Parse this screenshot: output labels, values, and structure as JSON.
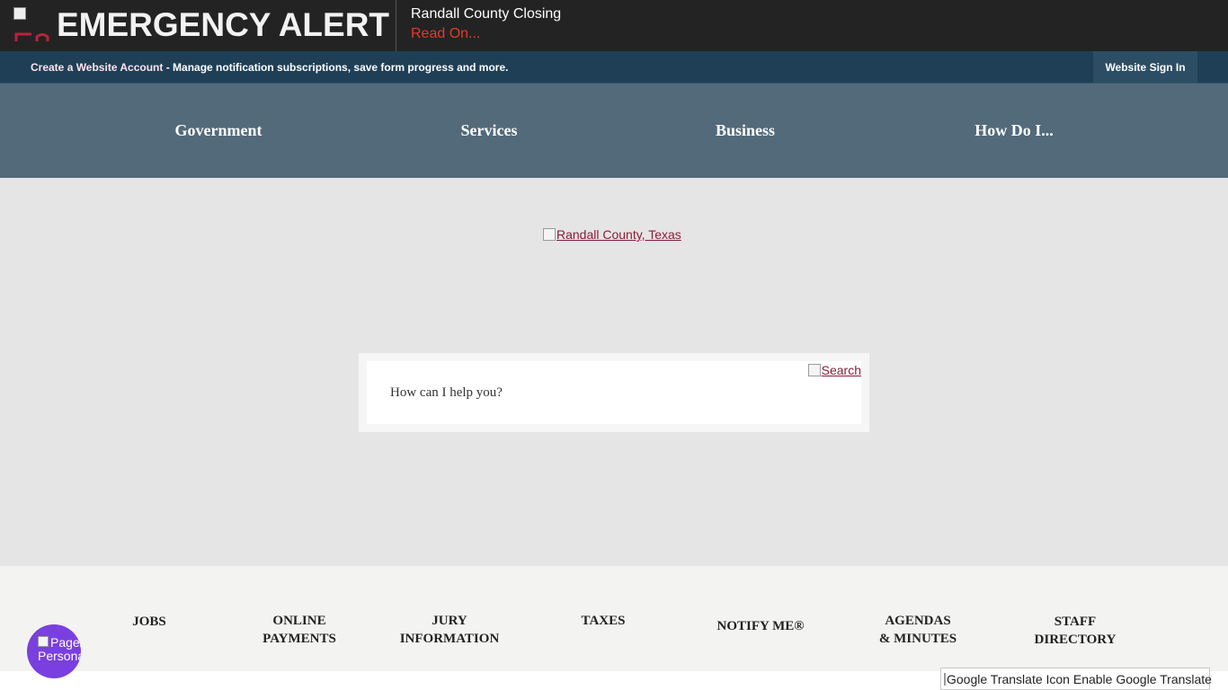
{
  "alert": {
    "title": "EMERGENCY ALERT",
    "message": "Randall County Closing",
    "read_on": "Read On..."
  },
  "account": {
    "create_link": "Create a Website Account",
    "description": " - Manage notification subscriptions, save form progress and more.",
    "sign_in": "Website Sign In"
  },
  "nav": {
    "items": [
      "Government",
      "Services",
      "Business",
      "How Do I..."
    ]
  },
  "hero": {
    "logo_alt": "Randall County, Texas",
    "search_placeholder": "How can I help you?",
    "search_alt": "Search"
  },
  "quick_links": [
    "JOBS",
    "ONLINE\nPAYMENTS",
    "JURY\nINFORMATION",
    "TAXES",
    "NOTIFY ME®",
    "AGENDAS\n& MINUTES",
    "STAFF\nDIRECTORY"
  ],
  "widgets": {
    "page_assist": "PageAssist Personalize",
    "translate": "Google Translate Icon Enable Google Translate"
  },
  "colors": {
    "alert_bg": "#232323",
    "alert_accent": "#e23a2b",
    "account_bg": "#1f3f56",
    "nav_bg": "#526a7a",
    "hero_bg": "#e5e5e5",
    "link": "#8a1c3a",
    "assist": "#7a3fe0"
  }
}
